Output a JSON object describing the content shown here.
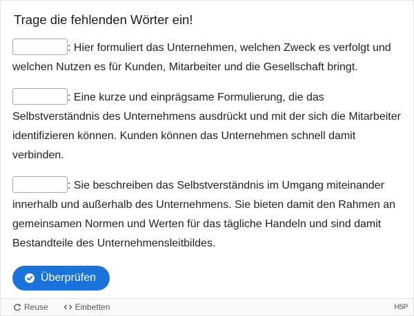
{
  "task": {
    "title": "Trage die fehlenden Wörter ein!"
  },
  "questions": [
    {
      "value": "",
      "text": ": Hier formuliert das Unternehmen, welchen Zweck es verfolgt und welchen Nutzen es für Kunden, Mitarbeiter und die Gesellschaft bringt."
    },
    {
      "value": "",
      "text": ": Eine kurze und einprägsame Formulierung, die das Selbstverständnis des Unternehmens ausdrückt und mit der sich die Mitarbeiter identifizieren können. Kunden können das Unternehmen schnell damit verbinden."
    },
    {
      "value": "",
      "text": ": Sie beschreiben das Selbstverständnis im Umgang miteinander innerhalb und außerhalb des Unternehmens. Sie bieten damit den Rahmen an gemeinsamen Normen und Werten für das tägliche Handeln und sind damit Bestandteile des Unternehmensleitbildes."
    }
  ],
  "actions": {
    "check_label": "Überprüfen",
    "check_icon": "check-circle-icon"
  },
  "footer": {
    "reuse_label": "Reuse",
    "reuse_icon": "reuse-icon",
    "embed_label": "Einbetten",
    "embed_icon": "embed-code-icon",
    "logo_text": "H5P"
  },
  "colors": {
    "accent": "#1a73d9",
    "input_border": "#a6a6a6",
    "footer_bg": "#fafafa"
  }
}
